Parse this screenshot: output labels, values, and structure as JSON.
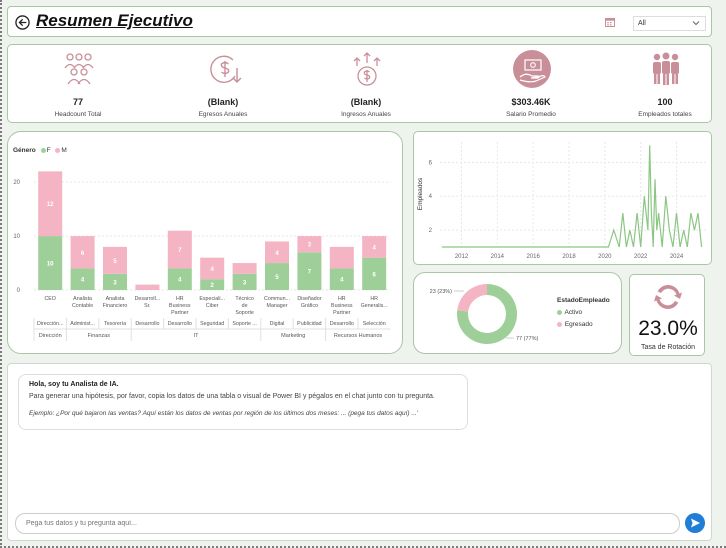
{
  "header": {
    "title": "Resumen Ejecutivo",
    "filter_value": "All"
  },
  "kpis": [
    {
      "value": "77",
      "label": "Headcount Total",
      "icon": "people-group-icon"
    },
    {
      "value": "(Blank)",
      "label": "Egresos Anuales",
      "icon": "money-out-icon"
    },
    {
      "value": "(Blank)",
      "label": "Ingresos Anuales",
      "icon": "money-growth-icon"
    },
    {
      "value": "$303.46K",
      "label": "Salario Promedio",
      "icon": "salary-hand-icon"
    },
    {
      "value": "100",
      "label": "Empleados totales",
      "icon": "employees-icon"
    }
  ],
  "colors": {
    "green": "#9fcf99",
    "pink": "#f4b4c4",
    "accent_pink": "#c98f98",
    "line": "#8cc684",
    "blue": "#1f7fd6"
  },
  "bar_chart": {
    "legend_title": "Género",
    "legend": [
      "F",
      "M"
    ]
  },
  "line_chart": {
    "ylabel": "Empleados"
  },
  "donut": {
    "legend_title": "EstadoEmpleado",
    "legend": [
      "Activo",
      "Egresado"
    ],
    "label_egresado": "23 (23%)",
    "label_activo": "77 (77%)"
  },
  "rotation": {
    "value": "23.0%",
    "label": "Tasa de Rotación"
  },
  "chat": {
    "greeting": "Hola, soy tu Analista de IA.",
    "body": "Para generar una hipótesis, por favor, copia los datos de una tabla o visual de Power BI y pégalos en el chat junto con tu pregunta.",
    "example": "Ejemplo: ¿Por qué bajaron las ventas? Aquí están los datos de ventas por región de los últimos dos meses: ... (pega tus datos aquí) ...'",
    "placeholder": "Pega tus datos y tu pregunta aquí..."
  },
  "chart_data": [
    {
      "type": "bar",
      "stacked": true,
      "categories": [
        "CEO",
        "Analista Contable",
        "Analista Financiero",
        "Desarroll... Sr.",
        "HR Business Partner",
        "Especiali... Ciber",
        "Técnico de Soporte",
        "Commun... Manager",
        "Diseñador Gráfico",
        "HR Business Partner",
        "HR Generalis..."
      ],
      "subgroups": [
        "Dirección...",
        "Administ...",
        "Tesorería",
        "Desarrollo",
        "Desarrollo",
        "Seguridad",
        "Soporte ...",
        "Digital",
        "Publicidad",
        "Desarrollo",
        "Selección"
      ],
      "groups": [
        {
          "name": "Dirección",
          "count": 1
        },
        {
          "name": "Finanzas",
          "count": 2
        },
        {
          "name": "IT",
          "count": 4
        },
        {
          "name": "Marketing",
          "count": 2
        },
        {
          "name": "Recursos Humanos",
          "count": 2
        }
      ],
      "series": [
        {
          "name": "F",
          "values": [
            10,
            4,
            3,
            0,
            4,
            2,
            3,
            5,
            7,
            4,
            6
          ],
          "labels": [
            "10",
            "4",
            "3",
            "",
            "4",
            "2",
            "3",
            "5",
            "7",
            "4",
            "6"
          ]
        },
        {
          "name": "M",
          "values": [
            12,
            6,
            5,
            1,
            7,
            4,
            2,
            4,
            3,
            4,
            4
          ],
          "labels": [
            "12",
            "6",
            "5",
            "",
            "7",
            "4",
            "",
            "4",
            "3",
            "",
            "4"
          ]
        }
      ],
      "yticks": [
        0,
        10,
        20
      ],
      "ylim": [
        0,
        23
      ]
    },
    {
      "type": "line",
      "ylabel": "Empleados",
      "xticks": [
        2012,
        2014,
        2016,
        2018,
        2020,
        2022,
        2024
      ],
      "yticks": [
        2,
        4,
        6
      ],
      "xlim": [
        2010.8,
        2025.7
      ],
      "ylim": [
        1,
        7.2
      ],
      "x": [
        2010.9,
        2020.2,
        2020.5,
        2020.8,
        2021.0,
        2021.2,
        2021.4,
        2021.6,
        2021.8,
        2022.0,
        2022.2,
        2022.4,
        2022.5,
        2022.6,
        2022.7,
        2022.8,
        2022.9,
        2023.0,
        2023.2,
        2023.4,
        2023.6,
        2023.8,
        2024.0,
        2024.2,
        2024.4,
        2024.6,
        2024.8,
        2025.0,
        2025.2,
        2025.4
      ],
      "y": [
        1,
        1,
        2,
        1,
        3,
        1,
        2,
        1,
        3,
        1,
        4,
        2,
        7,
        3,
        1,
        5,
        2,
        3,
        1,
        4,
        2,
        1,
        3,
        1,
        2,
        1,
        3,
        2,
        3,
        1
      ]
    },
    {
      "type": "pie",
      "donut": true,
      "labels": [
        "Activo",
        "Egresado"
      ],
      "values": [
        77,
        23
      ]
    }
  ]
}
